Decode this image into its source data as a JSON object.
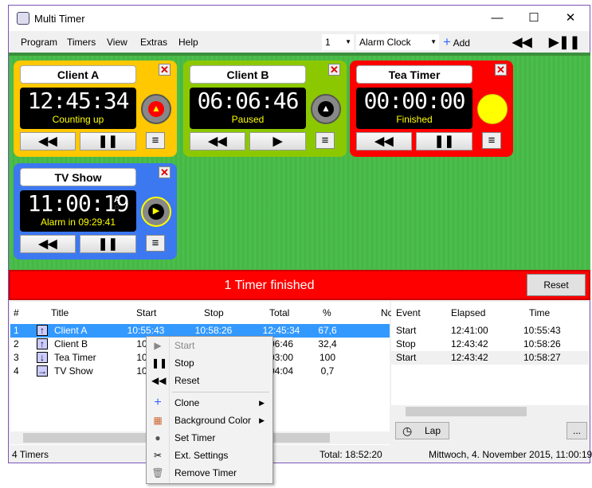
{
  "window": {
    "title": "Multi Timer"
  },
  "menu": [
    "Program",
    "Timers",
    "View",
    "Extras",
    "Help"
  ],
  "toolbar": {
    "count": "1",
    "preset": "Alarm Clock",
    "add": "Add"
  },
  "timers": [
    {
      "name": "Client A",
      "time": "12:45:34",
      "status": "Counting up",
      "color": "#ffc800"
    },
    {
      "name": "Client B",
      "time": "06:06:46",
      "status": "Paused",
      "color": "#8cc800"
    },
    {
      "name": "Tea Timer",
      "time": "00:00:00",
      "status": "Finished",
      "color": "#ff0000"
    },
    {
      "name": "TV Show",
      "time": "11:00:19",
      "status": "Alarm in 09:29:41",
      "color": "#3c78f0",
      "ampm": [
        "A",
        "P"
      ]
    }
  ],
  "banner": {
    "text": "1 Timer finished",
    "reset": "Reset"
  },
  "table": {
    "headers": [
      "#",
      "",
      "Title",
      "Start",
      "Stop",
      "Total",
      "%",
      "No"
    ],
    "rows": [
      {
        "n": "1",
        "dir": "up",
        "title": "Client A",
        "start": "10:55:43",
        "stop": "10:58:26",
        "total": "12:45:34",
        "pct": "67,6"
      },
      {
        "n": "2",
        "dir": "up",
        "title": "Client B",
        "start": "10:5",
        "stop": "",
        "total": "06:46",
        "pct": "32,4"
      },
      {
        "n": "3",
        "dir": "down",
        "title": "Tea Timer",
        "start": "10:5",
        "stop": "",
        "total": "03:00",
        "pct": "100"
      },
      {
        "n": "4",
        "dir": "right",
        "title": "TV Show",
        "start": "10:5",
        "stop": "",
        "total": "04:04",
        "pct": "0,7"
      }
    ]
  },
  "events": {
    "headers": [
      "Event",
      "Elapsed",
      "Time"
    ],
    "rows": [
      [
        "Start",
        "12:41:00",
        "10:55:43"
      ],
      [
        "Stop",
        "12:43:42",
        "10:58:26"
      ],
      [
        "Start",
        "12:43:42",
        "10:58:27"
      ]
    ],
    "lap": "Lap",
    "more": "..."
  },
  "status": {
    "count": "4 Timers",
    "total": "Total: 18:52:20",
    "datetime": "Mittwoch, 4. November 2015, 11:00:19"
  },
  "context_menu": [
    "Start",
    "Stop",
    "Reset",
    "Clone",
    "Background Color",
    "Set Timer",
    "Ext. Settings",
    "Remove  Timer"
  ]
}
